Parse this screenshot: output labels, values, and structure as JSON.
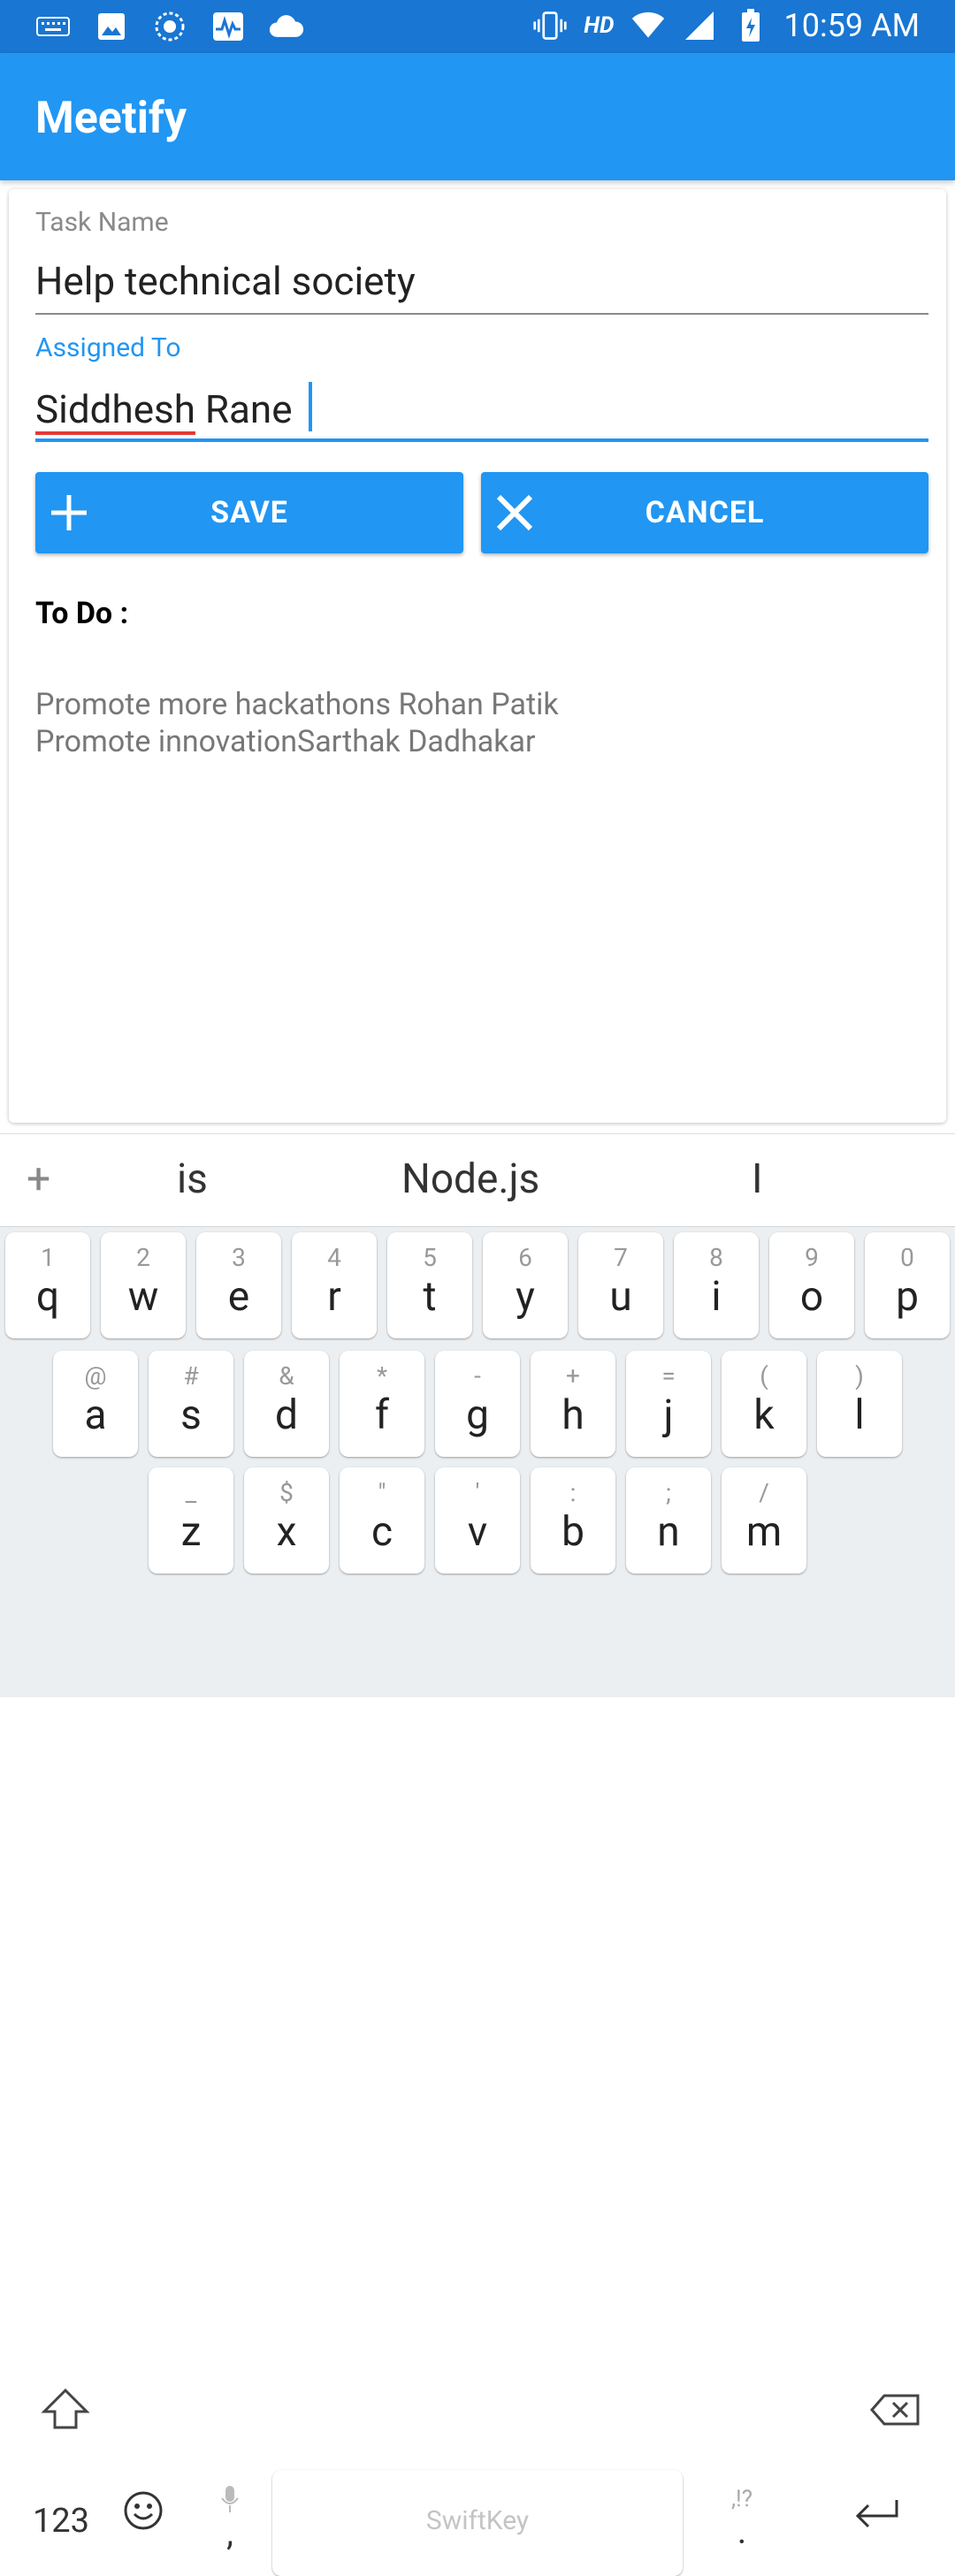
{
  "status_bar": {
    "left_icons": [
      "keyboard-icon",
      "image-icon",
      "sync-icon",
      "activity-icon",
      "cloud-icon"
    ],
    "right_icons": [
      "vibrate-icon",
      "hd-icon",
      "wifi-icon",
      "signal-icon",
      "battery-icon"
    ],
    "hd_label": "HD",
    "time": "10:59 AM"
  },
  "app_bar": {
    "title": "Meetify"
  },
  "form": {
    "task_name": {
      "label": "Task Name",
      "value": "Help technical society"
    },
    "assigned_to": {
      "label": "Assigned To",
      "value_first": "Siddhesh",
      "value_rest": " Rane "
    }
  },
  "buttons": {
    "save": "SAVE",
    "cancel": "CANCEL"
  },
  "todo": {
    "title": "To Do :",
    "items": [
      "Promote more hackathons Rohan Patik",
      "Promote innovationSarthak Dadhakar"
    ]
  },
  "keyboard": {
    "suggestions": [
      "is",
      "Node.js",
      "I"
    ],
    "row1": [
      [
        "1",
        "q"
      ],
      [
        "2",
        "w"
      ],
      [
        "3",
        "e"
      ],
      [
        "4",
        "r"
      ],
      [
        "5",
        "t"
      ],
      [
        "6",
        "y"
      ],
      [
        "7",
        "u"
      ],
      [
        "8",
        "i"
      ],
      [
        "9",
        "o"
      ],
      [
        "0",
        "p"
      ]
    ],
    "row2": [
      [
        "@",
        "a"
      ],
      [
        "#",
        "s"
      ],
      [
        "&",
        "d"
      ],
      [
        "*",
        "f"
      ],
      [
        "-",
        "g"
      ],
      [
        "+",
        "h"
      ],
      [
        "=",
        "j"
      ],
      [
        "(",
        "k"
      ],
      [
        ")",
        "l"
      ]
    ],
    "row3": [
      [
        "_",
        "z"
      ],
      [
        "$",
        "x"
      ],
      [
        "\"",
        "c"
      ],
      [
        "'",
        "v"
      ],
      [
        ":",
        "b"
      ],
      [
        ";",
        "n"
      ],
      [
        "/",
        "m"
      ]
    ],
    "numbers_key": "123",
    "comma_key": ",",
    "period_key": ".",
    "period_hint": ",!?",
    "space_brand": "SwiftKey"
  },
  "colors": {
    "primary": "#2196f3",
    "primary_dark": "#1976d2",
    "spell_error": "#e53935"
  }
}
